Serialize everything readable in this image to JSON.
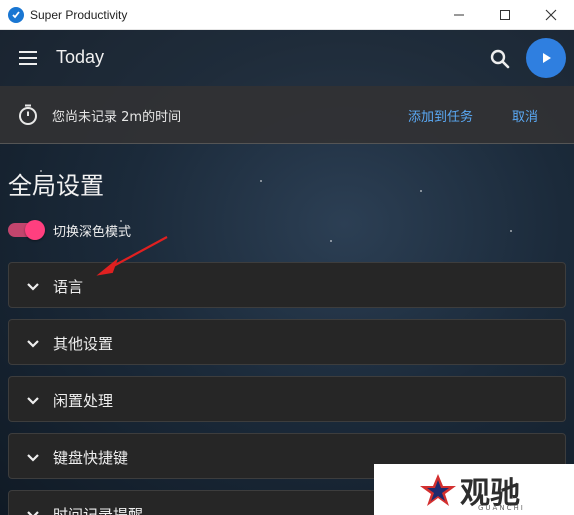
{
  "window": {
    "title": "Super Productivity",
    "controls": [
      "minimize-icon",
      "maximize-icon",
      "close-icon"
    ]
  },
  "toolbar": {
    "title": "Today",
    "icons": [
      "menu-icon",
      "search-icon",
      "play-icon"
    ]
  },
  "banner": {
    "message": "您尚未记录 2m的时间",
    "add_to_task": "添加到任务",
    "cancel": "取消",
    "icon": "timer-icon"
  },
  "settings": {
    "heading": "全局设置",
    "dark_mode_label": "切换深色模式",
    "dark_mode_on": true,
    "sections": [
      {
        "label": "语言"
      },
      {
        "label": "其他设置"
      },
      {
        "label": "闲置处理"
      },
      {
        "label": "键盘快捷键"
      },
      {
        "label": "时间记录提醒"
      }
    ]
  },
  "colors": {
    "accent": "#2f7fe0",
    "link": "#5aa9f5",
    "toggle": "#ff3f7f",
    "annotation_arrow": "#e02020"
  },
  "watermark": {
    "text": "观驰",
    "subtext": "GUANCHI"
  }
}
